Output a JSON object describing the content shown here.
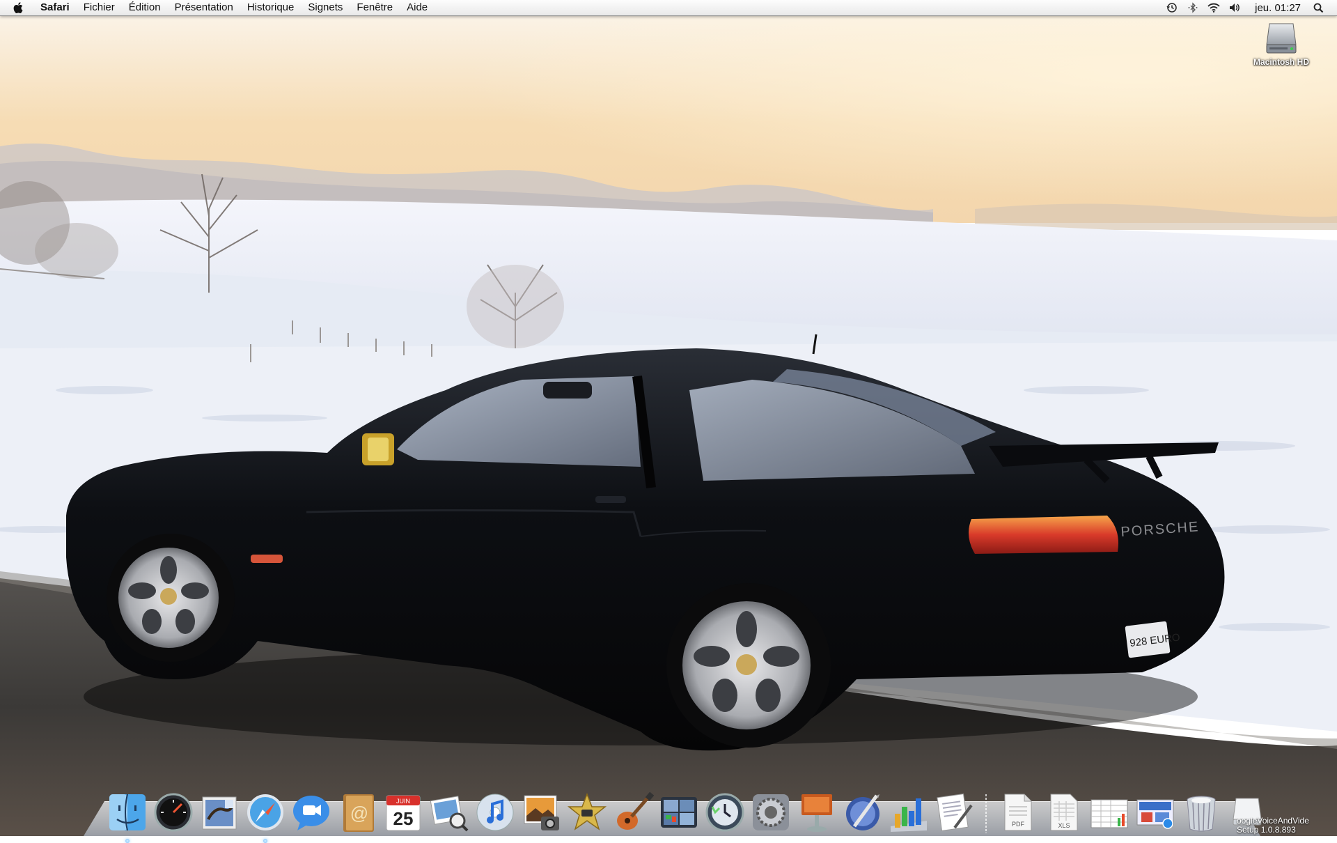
{
  "menubar": {
    "app_name": "Safari",
    "menus": [
      "Fichier",
      "Édition",
      "Présentation",
      "Historique",
      "Signets",
      "Fenêtre",
      "Aide"
    ],
    "clock": "jeu. 01:27",
    "status_icons": [
      "time-machine-icon",
      "bluetooth-icon",
      "wifi-icon",
      "volume-icon",
      "spotlight-icon"
    ]
  },
  "desktop": {
    "wallpaper": "black sports car on snowy road at sunset",
    "car_plate": "928 EURO",
    "car_badge": "PORSCHE",
    "icons": [
      {
        "label": "Macintosh HD",
        "icon": "hard-drive-icon"
      }
    ]
  },
  "dock": {
    "apps": [
      {
        "name": "Finder",
        "icon": "finder-icon",
        "running": true
      },
      {
        "name": "Dashboard",
        "icon": "dashboard-icon",
        "running": false
      },
      {
        "name": "Mail",
        "icon": "mail-icon",
        "running": false
      },
      {
        "name": "Safari",
        "icon": "safari-icon",
        "running": true
      },
      {
        "name": "iChat",
        "icon": "ichat-icon",
        "running": false
      },
      {
        "name": "Carnet d'adresses",
        "icon": "address-book-icon",
        "running": false
      },
      {
        "name": "iCal",
        "icon": "ical-icon",
        "running": false,
        "month": "JUIN",
        "day": "25"
      },
      {
        "name": "Aperçu",
        "icon": "preview-icon",
        "running": false
      },
      {
        "name": "iTunes",
        "icon": "itunes-icon",
        "running": false
      },
      {
        "name": "iPhoto",
        "icon": "iphoto-icon",
        "running": false
      },
      {
        "name": "iMovie",
        "icon": "imovie-icon",
        "running": false
      },
      {
        "name": "GarageBand",
        "icon": "garageband-icon",
        "running": false
      },
      {
        "name": "Spaces",
        "icon": "spaces-icon",
        "running": false
      },
      {
        "name": "Time Machine",
        "icon": "time-machine-icon",
        "running": false
      },
      {
        "name": "Préférences Système",
        "icon": "system-preferences-icon",
        "running": false
      },
      {
        "name": "Keynote",
        "icon": "keynote-icon",
        "running": false
      },
      {
        "name": "iWeb",
        "icon": "iweb-icon",
        "running": false
      },
      {
        "name": "Numbers",
        "icon": "numbers-icon",
        "running": false
      },
      {
        "name": "Pages",
        "icon": "pages-icon",
        "running": false
      }
    ],
    "documents": [
      {
        "name": "PDF",
        "icon": "pdf-document-icon",
        "label": "PDF"
      },
      {
        "name": "XLS",
        "icon": "xls-document-icon",
        "label": "XLS"
      },
      {
        "name": "Spreadsheet stack",
        "icon": "spreadsheet-stack-icon"
      },
      {
        "name": "Downloads stack",
        "icon": "downloads-stack-icon"
      },
      {
        "name": "Corbeille",
        "icon": "trash-icon"
      },
      {
        "name": "GoogleVoiceAndVideoSetup 1.0.8.893",
        "icon": "volume-disk-icon"
      }
    ],
    "mounted_volume_label": "oogleVoiceAndVide",
    "mounted_volume_label2": "Setup 1.0.8.893"
  },
  "colors": {
    "sky_top": "#f7e9d4",
    "sky_horizon": "#f3d3a3",
    "snow": "#eef2f8",
    "road": "#3d3a38",
    "car_body": "#0b0c0f",
    "taillight": "#e03a2a"
  }
}
